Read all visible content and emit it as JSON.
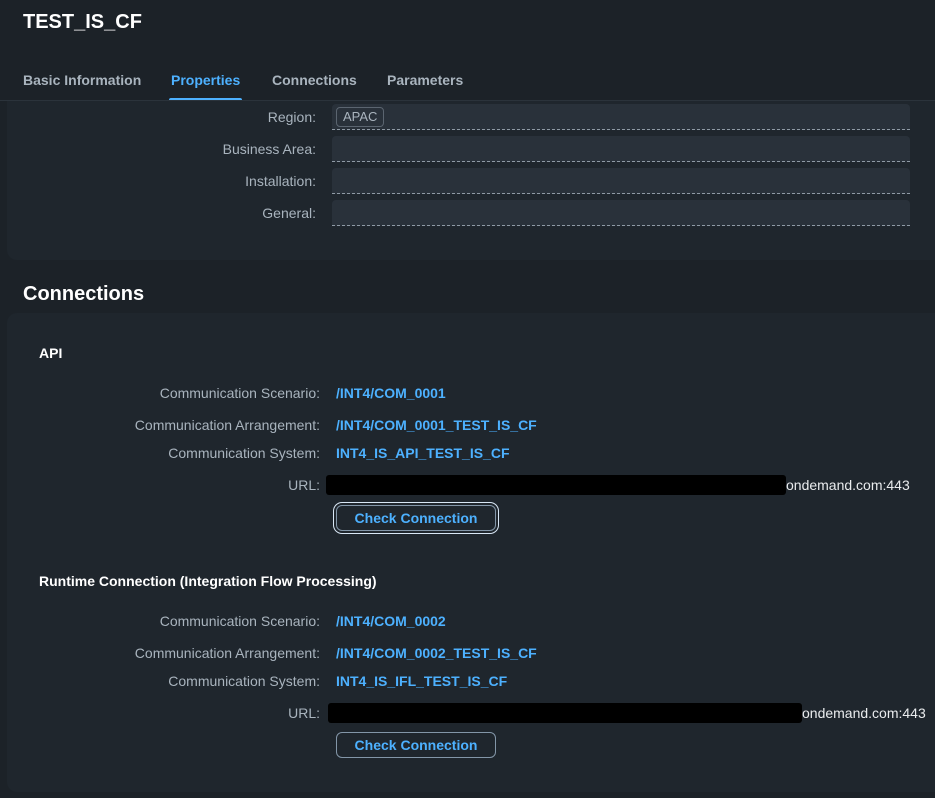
{
  "header": {
    "title": "TEST_IS_CF",
    "tabs": [
      {
        "label": "Basic Information",
        "active": false
      },
      {
        "label": "Properties",
        "active": true
      },
      {
        "label": "Connections",
        "active": false
      },
      {
        "label": "Parameters",
        "active": false
      }
    ]
  },
  "properties": {
    "rows": [
      {
        "label": "Region:",
        "token": "APAC"
      },
      {
        "label": "Business Area:",
        "token": ""
      },
      {
        "label": "Installation:",
        "token": ""
      },
      {
        "label": "General:",
        "token": ""
      }
    ]
  },
  "connections": {
    "title": "Connections",
    "groups": [
      {
        "title": "API",
        "scenario_label": "Communication Scenario:",
        "scenario": "/INT4/COM_0001",
        "arrangement_label": "Communication Arrangement:",
        "arrangement": "/INT4/COM_0001_TEST_IS_CF",
        "system_label": "Communication System:",
        "system": "INT4_IS_API_TEST_IS_CF",
        "url_label": "URL:",
        "url_suffix": "ondemand.com:443",
        "button": "Check Connection"
      },
      {
        "title": "Runtime Connection (Integration Flow Processing)",
        "scenario_label": "Communication Scenario:",
        "scenario": "/INT4/COM_0002",
        "arrangement_label": "Communication Arrangement:",
        "arrangement": "/INT4/COM_0002_TEST_IS_CF",
        "system_label": "Communication System:",
        "system": "INT4_IS_IFL_TEST_IS_CF",
        "url_label": "URL:",
        "url_suffix": "ondemand.com:443",
        "button": "Check Connection"
      }
    ]
  },
  "colors": {
    "background": "#1c2228",
    "card": "#1f262d",
    "link": "#4db1ff",
    "label": "#a9b4be"
  }
}
